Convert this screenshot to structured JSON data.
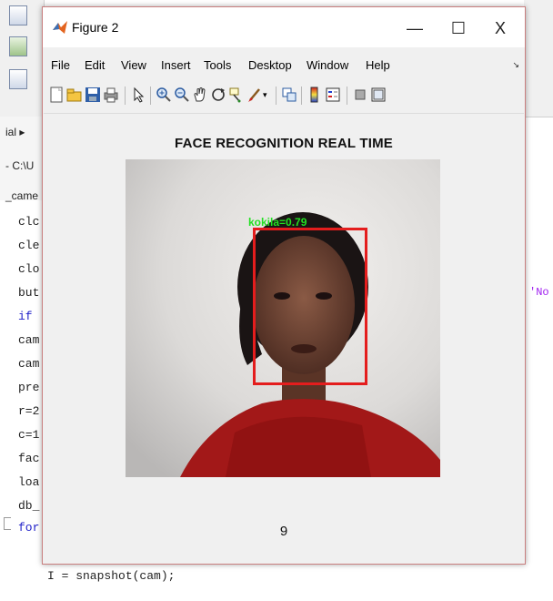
{
  "editor": {
    "path_fragment": "- C:\\U",
    "file_tab": "_came",
    "panel_label": "ial ▸",
    "code_lines": [
      "clc",
      "cle",
      "clo",
      "but",
      "if",
      "cam",
      "cam",
      "pre",
      "r=2",
      "c=1",
      "fac",
      "loa",
      "db_",
      "for"
    ],
    "right_string": "'No",
    "bottom_line": "I = snapshot(cam);"
  },
  "figure": {
    "title": "Figure 2",
    "controls": {
      "minimize": "—",
      "maximize": "☐",
      "close": "X"
    },
    "menu": [
      "File",
      "Edit",
      "View",
      "Insert",
      "Tools",
      "Desktop",
      "Window",
      "Help"
    ],
    "menu_dock_arrow": "↘",
    "toolbar_icons": [
      "new-figure-icon",
      "open-file-icon",
      "save-icon",
      "print-icon",
      "select-arrow-icon",
      "zoom-in-icon",
      "zoom-out-icon",
      "pan-icon",
      "rotate-3d-icon",
      "data-cursor-icon",
      "brush-icon",
      "link-plot-icon",
      "colorbar-icon",
      "legend-icon",
      "hide-plot-tools-icon",
      "show-plot-tools-icon"
    ],
    "plot": {
      "title": "FACE RECOGNITION REAL TIME",
      "detection_label": "kokila=0.79",
      "frame_counter": "9"
    }
  },
  "colors": {
    "box": "#e41d1d",
    "label": "#22e022",
    "keyword": "#1f1fc8",
    "string": "#a020f0",
    "window_border": "#c97f7f"
  }
}
